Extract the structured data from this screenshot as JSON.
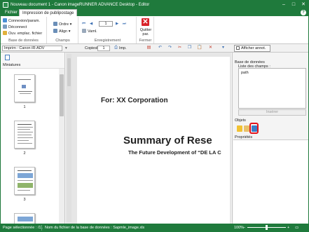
{
  "window": {
    "title": "Nouveau document 1 - Canon imageRUNNER ADVANCE Desktop - Editor",
    "minimize": "–",
    "maximize": "□",
    "close": "✕"
  },
  "menu": {
    "file": "Fichier",
    "publipostage": "Impression de publipostage",
    "help": "?"
  },
  "ribbon": {
    "db": {
      "connect": "Connexion/param.",
      "disconnect": "Déconnect",
      "open": "Ouv. emplac. fichier",
      "label": "Base de données"
    },
    "fields": {
      "order": "Ordre",
      "align": "Align",
      "label": "Champs"
    },
    "record": {
      "value": "1",
      "invert": "Vaml.",
      "label": "Enregistrement"
    },
    "close": {
      "quit": "Quitter",
      "quit2": "par.",
      "label": "Fermer"
    }
  },
  "toolbar": {
    "printer": "Imprim : Canon iR-ADV",
    "copies_label": "Copiesl",
    "copies_value": "1",
    "print_label": "Imp.",
    "annot_label": "Afficher annot."
  },
  "left": {
    "panel_title": "Miniatures",
    "pages": [
      "1",
      "2",
      "3"
    ]
  },
  "document": {
    "heading": "For: XX Corporation",
    "title": "Summary of Rese",
    "subtitle": "The Future Development of “DE LA C"
  },
  "right": {
    "db_title": "Base de données",
    "fields_label": "Liste des champs :",
    "fields": [
      "path"
    ],
    "insert": "Insérer",
    "objects": "Objets",
    "properties": "Propriétés"
  },
  "status": {
    "selection": "Page sélectionnée : /11",
    "filename": "Nom du fichier de la base de données : Sapmle_image.xls",
    "zoom": "100%",
    "zoom_minus": "−",
    "zoom_plus": "+"
  },
  "colors": {
    "accent": "#1f7a3c",
    "highlight": "#e3141c",
    "quit": "#d9232a"
  }
}
